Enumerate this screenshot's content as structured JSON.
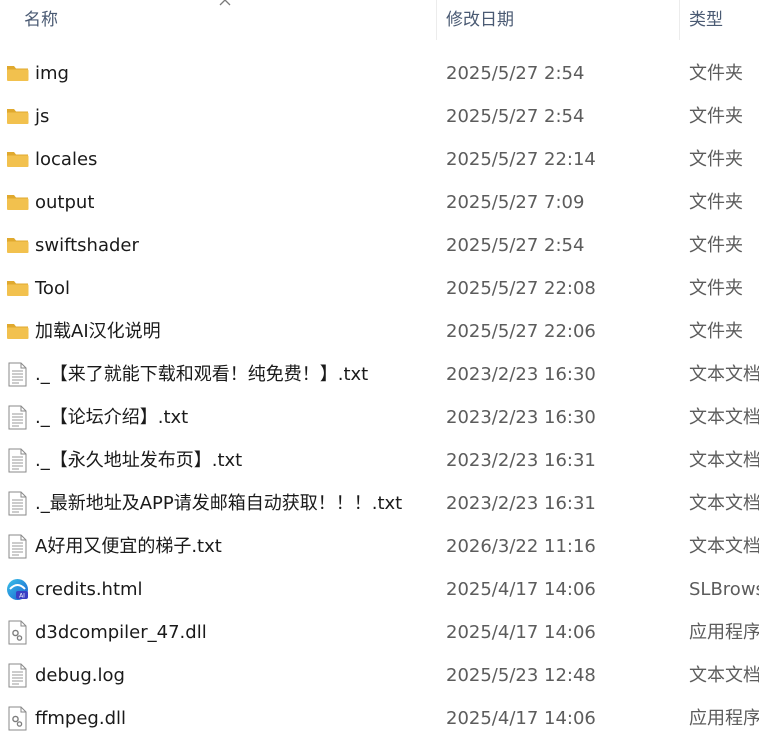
{
  "header": {
    "columns": {
      "name": "名称",
      "date": "修改日期",
      "type": "类型"
    },
    "sorted_by": "名称"
  },
  "colors": {
    "folder": "#f2c14e",
    "folder_dark": "#e0a92e",
    "text": "#1a1a1a",
    "muted": "#5c5c5c"
  },
  "files": [
    {
      "name": "img",
      "date": "2025/5/27 2:54",
      "type": "文件夹",
      "icon": "folder-icon"
    },
    {
      "name": "js",
      "date": "2025/5/27 2:54",
      "type": "文件夹",
      "icon": "folder-icon"
    },
    {
      "name": "locales",
      "date": "2025/5/27 22:14",
      "type": "文件夹",
      "icon": "folder-icon"
    },
    {
      "name": "output",
      "date": "2025/5/27 7:09",
      "type": "文件夹",
      "icon": "folder-icon"
    },
    {
      "name": "swiftshader",
      "date": "2025/5/27 2:54",
      "type": "文件夹",
      "icon": "folder-icon"
    },
    {
      "name": "Tool",
      "date": "2025/5/27 22:08",
      "type": "文件夹",
      "icon": "folder-icon"
    },
    {
      "name": "加载AI汉化说明",
      "date": "2025/5/27 22:06",
      "type": "文件夹",
      "icon": "folder-icon"
    },
    {
      "name": "._【来了就能下载和观看！纯免费！】.txt",
      "date": "2023/2/23 16:30",
      "type": "文本文档",
      "icon": "text-document-icon"
    },
    {
      "name": "._【论坛介绍】.txt",
      "date": "2023/2/23 16:30",
      "type": "文本文档",
      "icon": "text-document-icon"
    },
    {
      "name": "._【永久地址发布页】.txt",
      "date": "2023/2/23 16:31",
      "type": "文本文档",
      "icon": "text-document-icon"
    },
    {
      "name": "._最新地址及APP请发邮箱自动获取！！！.txt",
      "date": "2023/2/23 16:31",
      "type": "文本文档",
      "icon": "text-document-icon"
    },
    {
      "name": "A好用又便宜的梯子.txt",
      "date": "2026/3/22 11:16",
      "type": "文本文档",
      "icon": "text-document-icon"
    },
    {
      "name": "credits.html",
      "date": "2025/4/17 14:06",
      "type": "SLBrows",
      "icon": "browser-icon"
    },
    {
      "name": "d3dcompiler_47.dll",
      "date": "2025/4/17 14:06",
      "type": "应用程序",
      "icon": "dll-file-icon"
    },
    {
      "name": "debug.log",
      "date": "2025/5/23 12:48",
      "type": "文本文档",
      "icon": "text-document-icon"
    },
    {
      "name": "ffmpeg.dll",
      "date": "2025/4/17 14:06",
      "type": "应用程序",
      "icon": "dll-file-icon"
    }
  ]
}
